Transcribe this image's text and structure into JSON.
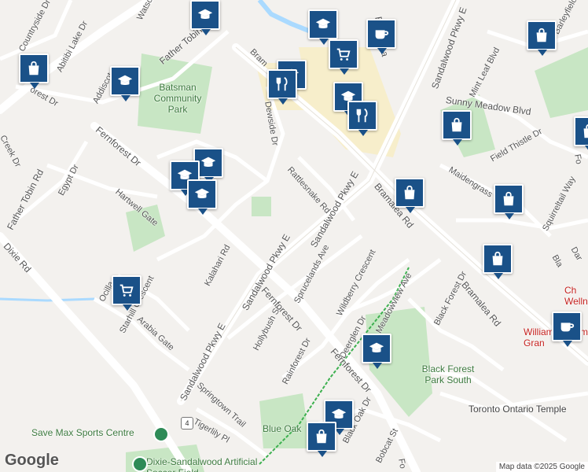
{
  "map": {
    "logo": "Google",
    "attribution": "Map data ©2025 Google",
    "colors": {
      "land": "#f3f1ee",
      "road": "#ffffff",
      "park": "#c8e6c4",
      "water": "#aadaff",
      "commercial": "#f7eecb",
      "marker": "#1a5188",
      "trail": "#3cb04f"
    },
    "streets": [
      "Countryside Dr",
      "Watsonbr",
      "Father Tobin",
      "Abitibi Lake Dr",
      "orest Dr",
      "Addiscot",
      "Creek Dr",
      "Father Tobin Rd",
      "Egypt Dr",
      "Fernforest Dr",
      "Hartwell Gate",
      "Dixie Rd",
      "Kalahari Rd",
      "Ocilla",
      "Starhill Crescent",
      "Arabia Gate",
      "Sandalwood Pkwy E",
      "Sandalwood Pkwy E",
      "Hollybush St",
      "Fernforest Dr",
      "Sprucelands Ave",
      "Rainforest Dr",
      "Deerglen Dr",
      "Fernforest Dr",
      "Springtown Trail",
      "Tigerlily Pl",
      "Black Oak Dr",
      "Bobcat St",
      "Dewside Dr",
      "Rattlesnake Rd",
      "Sandalwood Pkwy E",
      "Bramalea Rd",
      "Wildberry Crescent",
      "Meadowview Ave",
      "Black Forest Dr",
      "Bramalea Rd",
      "Mint Leaf Blvd",
      "Sunny Meadow Blvd",
      "Field Thistle Dr",
      "Maidengrass Cres",
      "Squirreltail Way",
      "Barleyfield Rd",
      "Sandalwood Pkwy E",
      "Bramalea",
      "Bram",
      "Dar",
      "Fo",
      "Fo",
      "Bla"
    ],
    "places": [
      "Batsman Community Park",
      "Black Forest Park South",
      "Blue Oak",
      "Toronto Ontario Temple",
      "Save Max Sports Centre",
      "Dixie-Sandalwood Artificial Soccer Field",
      "William System Gran",
      "Ch Welln"
    ],
    "road_shield": "4",
    "marker_icons": [
      "school-icon",
      "shopping-bag-icon",
      "restaurant-icon",
      "grocery-cart-icon",
      "cafe-icon"
    ]
  }
}
